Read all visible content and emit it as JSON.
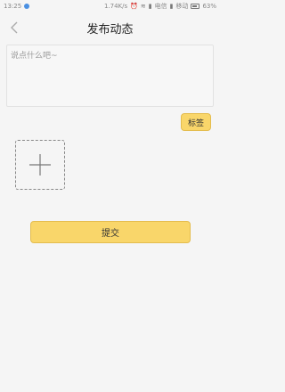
{
  "status_bar": {
    "time": "13:25",
    "net_speed": "1.74K/s",
    "carrier_1": "电信",
    "carrier_2": "移动",
    "battery": "63%"
  },
  "nav": {
    "title": "发布动态"
  },
  "post": {
    "placeholder": "说点什么吧~"
  },
  "tag_button": {
    "label": "标签"
  },
  "submit_button": {
    "label": "提交"
  },
  "colors": {
    "accent": "#f9d66a",
    "accent_border": "#e4bc4e",
    "background": "#f5f5f5"
  }
}
